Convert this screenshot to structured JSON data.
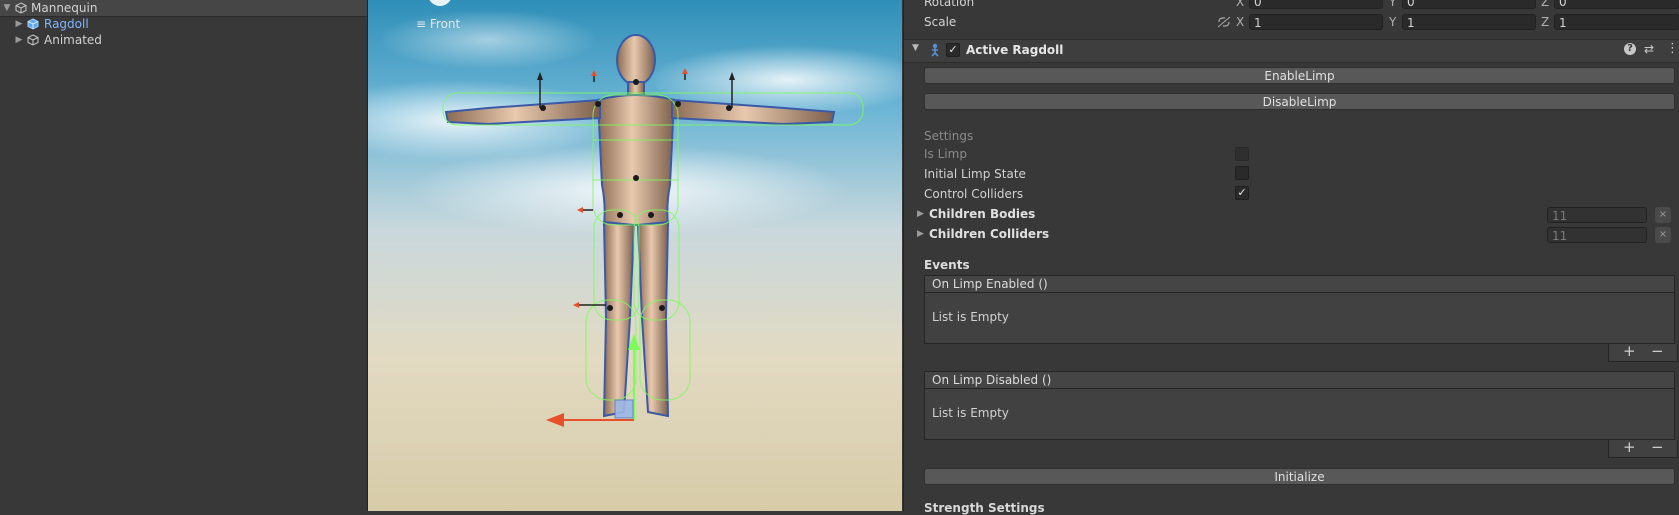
{
  "hierarchy": {
    "items": [
      {
        "label": "Mannequin"
      },
      {
        "label": "Ragdoll"
      },
      {
        "label": "Animated"
      }
    ]
  },
  "scene": {
    "view_label": "Front"
  },
  "inspector": {
    "rotation": {
      "label": "Rotation",
      "x": "0",
      "y": "0",
      "z": "0"
    },
    "scale": {
      "label": "Scale",
      "x": "1",
      "y": "1",
      "z": "1"
    },
    "axis": {
      "x": "X",
      "y": "Y",
      "z": "Z"
    },
    "component": {
      "title": "Active Ragdoll"
    },
    "buttons": {
      "enable": "EnableLimp",
      "disable": "DisableLimp",
      "initialize": "Initialize"
    },
    "settings": {
      "header": "Settings",
      "is_limp": "Is Limp",
      "initial_limp_state": "Initial Limp State",
      "control_colliders": "Control Colliders",
      "control_colliders_checked": true,
      "children_bodies": "Children Bodies",
      "children_bodies_count": "11",
      "children_colliders": "Children Colliders",
      "children_colliders_count": "11"
    },
    "events": {
      "header": "Events",
      "on_limp_enabled": "On Limp Enabled ()",
      "on_limp_disabled": "On Limp Disabled ()",
      "empty_text": "List is Empty",
      "add": "+",
      "remove": "−"
    },
    "next_section": "Strength Settings"
  },
  "colors": {
    "panel": "#383838",
    "selection_text": "#7fb6ff",
    "gizmo_green": "#7CFC5A",
    "gizmo_red": "#e8502a"
  }
}
